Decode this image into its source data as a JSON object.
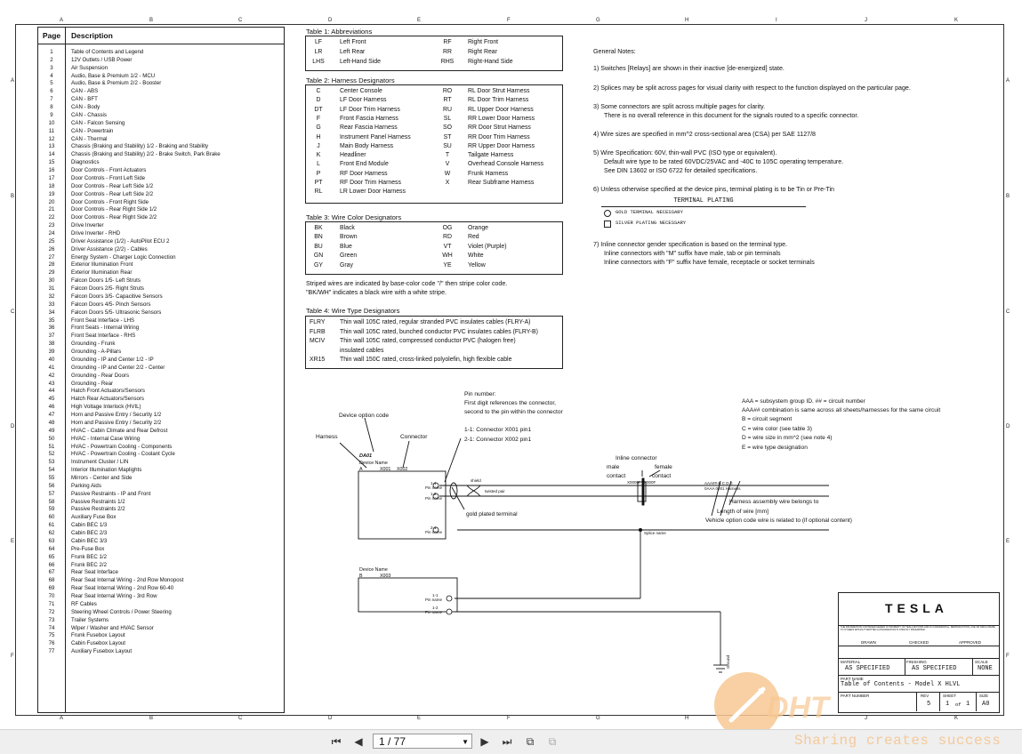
{
  "sheet": {
    "columns": [
      "A",
      "B",
      "C",
      "D",
      "E",
      "F",
      "G",
      "H",
      "I",
      "J",
      "K"
    ],
    "rows": [
      "A",
      "B",
      "C",
      "D",
      "E",
      "F"
    ]
  },
  "toc": {
    "header_page": "Page",
    "header_description": "Description",
    "rows": [
      [
        "1",
        "Table of Contents and Legend"
      ],
      [
        "2",
        "12V Outlets / USB Power"
      ],
      [
        "3",
        "Air Suspension"
      ],
      [
        "4",
        "Audio, Base & Premium 1/2 - MCU"
      ],
      [
        "5",
        "Audio, Base & Premium 2/2 - Booster"
      ],
      [
        "6",
        "CAN - ABS"
      ],
      [
        "7",
        "CAN - BFT"
      ],
      [
        "8",
        "CAN - Body"
      ],
      [
        "9",
        "CAN - Chassis"
      ],
      [
        "10",
        "CAN - Falcon Sensing"
      ],
      [
        "11",
        "CAN - Powertrain"
      ],
      [
        "12",
        "CAN - Thermal"
      ],
      [
        "13",
        "Chassis (Braking and Stability) 1/2 - Braking and Stability"
      ],
      [
        "14",
        "Chassis (Braking and Stability) 2/2 - Brake Switch, Park Brake"
      ],
      [
        "15",
        "Diagnostics"
      ],
      [
        "16",
        "Door Controls - Front Actuators"
      ],
      [
        "17",
        "Door Controls - Front Left Side"
      ],
      [
        "18",
        "Door Controls - Rear Left Side 1/2"
      ],
      [
        "19",
        "Door Controls - Rear Left Side 2/2"
      ],
      [
        "20",
        "Door Controls - Front Right Side"
      ],
      [
        "21",
        "Door Controls - Rear Right Side 1/2"
      ],
      [
        "22",
        "Door Controls - Rear Right Side 2/2"
      ],
      [
        "23",
        "Drive Inverter"
      ],
      [
        "24",
        "Drive Inverter - RHD"
      ],
      [
        "25",
        "Driver Assistance (1/2) - AutoPilot ECU 2"
      ],
      [
        "26",
        "Driver Assistance (2/2) - Cables"
      ],
      [
        "27",
        "Energy System - Charger Logic Connection"
      ],
      [
        "28",
        "Exterior Illumination Front"
      ],
      [
        "29",
        "Exterior Illumination Rear"
      ],
      [
        "30",
        "Falcon Doors 1/5- Left Struts"
      ],
      [
        "31",
        "Falcon Doors 2/5- Right Struts"
      ],
      [
        "32",
        "Falcon Doors 3/5- Capacitive Sensors"
      ],
      [
        "33",
        "Falcon Doors 4/5- Pinch Sensors"
      ],
      [
        "34",
        "Falcon Doors 5/5- Ultrasonic Sensors"
      ],
      [
        "35",
        "Front Seat Interface - LHS"
      ],
      [
        "36",
        "Front Seats - Internal Wiring"
      ],
      [
        "37",
        "Front Seat Interface - RHS"
      ],
      [
        "38",
        "Grounding - Frunk"
      ],
      [
        "39",
        "Grounding - A-Pillars"
      ],
      [
        "40",
        "Grounding - IP and Center 1/2 - IP"
      ],
      [
        "41",
        "Grounding - IP and Center 2/2 - Center"
      ],
      [
        "42",
        "Grounding - Rear Doors"
      ],
      [
        "43",
        "Grounding - Rear"
      ],
      [
        "44",
        "Hatch Front Actuators/Sensors"
      ],
      [
        "45",
        "Hatch Rear Actuators/Sensors"
      ],
      [
        "46",
        "High Voltage Interlock (HVIL)"
      ],
      [
        "47",
        "Horn and Passive Entry / Security 1/2"
      ],
      [
        "48",
        "Horn and Passive Entry / Security 2/2"
      ],
      [
        "49",
        "HVAC - Cabin Climate and Rear Defrost"
      ],
      [
        "50",
        "HVAC - Internal Case Wiring"
      ],
      [
        "51",
        "HVAC - Powertrain Cooling - Components"
      ],
      [
        "52",
        "HVAC - Powertrain Cooling - Coolant Cycle"
      ],
      [
        "53",
        "Instrument Cluster / LIN"
      ],
      [
        "54",
        "Interior Illumination Maplights"
      ],
      [
        "55",
        "Mirrors - Center and Side"
      ],
      [
        "56",
        "Parking Aids"
      ],
      [
        "57",
        "Passive Restraints - IP and Front"
      ],
      [
        "58",
        "Passive Restraints 1/2"
      ],
      [
        "59",
        "Passive Restraints 2/2"
      ],
      [
        "60",
        "Auxiliary Fuse Box"
      ],
      [
        "61",
        "Cabin BEC 1/3"
      ],
      [
        "62",
        "Cabin BEC 2/3"
      ],
      [
        "63",
        "Cabin BEC 3/3"
      ],
      [
        "64",
        "Pre-Fuse Box"
      ],
      [
        "65",
        "Frunk BEC 1/2"
      ],
      [
        "66",
        "Frunk BEC 2/2"
      ],
      [
        "67",
        "Rear Seat Interface"
      ],
      [
        "68",
        "Rear Seat Internal Wiring - 2nd Row Monopost"
      ],
      [
        "69",
        "Rear Seat Internal Wiring - 2nd Row 60-40"
      ],
      [
        "70",
        "Rear Seat Internal Wiring - 3rd Row"
      ],
      [
        "71",
        "RF Cables"
      ],
      [
        "72",
        "Steering Wheel Controls / Power Steering"
      ],
      [
        "73",
        "Trailer Systems"
      ],
      [
        "74",
        "Wiper / Washer and HVAC Sensor"
      ],
      [
        "75",
        "Frunk Fusebox Layout"
      ],
      [
        "76",
        "Cabin Fusebox Layout"
      ],
      [
        "77",
        "Auxiliary Fusebox Layout"
      ]
    ]
  },
  "tables": {
    "abbr": {
      "title": "Table 1: Abbreviations",
      "left": [
        [
          "LF",
          "Left Front"
        ],
        [
          "LR",
          "Left Rear"
        ],
        [
          "LHS",
          "Left-Hand Side"
        ]
      ],
      "right": [
        [
          "RF",
          "Right Front"
        ],
        [
          "RR",
          "Right Rear"
        ],
        [
          "RHS",
          "Right-Hand Side"
        ]
      ]
    },
    "harness": {
      "title": "Table 2: Harness Designators",
      "left": [
        [
          "C",
          "Center Console"
        ],
        [
          "D",
          "LF Door Harness"
        ],
        [
          "DT",
          "LF Door Trim Harness"
        ],
        [
          "F",
          "Front Fascia Harness"
        ],
        [
          "G",
          "Rear Fascia Harness"
        ],
        [
          "H",
          "Instrument Panel Harness"
        ],
        [
          "J",
          "Main Body Harness"
        ],
        [
          "K",
          "Headliner"
        ],
        [
          "L",
          "Front End Module"
        ],
        [
          "P",
          "RF Door Harness"
        ],
        [
          "PT",
          "RF Door Trim Harness"
        ],
        [
          "RL",
          "LR Lower Door Harness"
        ]
      ],
      "right": [
        [
          "RO",
          "RL Door Strut Harness"
        ],
        [
          "RT",
          "RL Door Trim Harness"
        ],
        [
          "RU",
          "RL Upper Door Harness"
        ],
        [
          "SL",
          "RR Lower Door Harness"
        ],
        [
          "SO",
          "RR Door Strut Harness"
        ],
        [
          "ST",
          "RR Door Trim Harness"
        ],
        [
          "SU",
          "RR Upper Door Harness"
        ],
        [
          "T",
          "Tailgate Harness"
        ],
        [
          "V",
          "Overhead Console Harness"
        ],
        [
          "W",
          "Frunk Harness"
        ],
        [
          "X",
          "Rear Subframe Harness"
        ]
      ]
    },
    "wirecolor": {
      "title": "Table 3: Wire Color Designators",
      "left": [
        [
          "BK",
          "Black"
        ],
        [
          "BN",
          "Brown"
        ],
        [
          "BU",
          "Blue"
        ],
        [
          "GN",
          "Green"
        ],
        [
          "GY",
          "Gray"
        ]
      ],
      "right": [
        [
          "OG",
          "Orange"
        ],
        [
          "RD",
          "Red"
        ],
        [
          "VT",
          "Violet (Purple)"
        ],
        [
          "WH",
          "White"
        ],
        [
          "YE",
          "Yellow"
        ]
      ],
      "note1": "Striped wires are indicated by base-color code \"/\" then stripe color code.",
      "note2": "\"BK/WH\" indicates a black wire with a white stripe."
    },
    "wiretype": {
      "title": "Table 4: Wire Type Designators",
      "rows": [
        [
          "FLRY",
          "Thin wall 105C rated, regular stranded PVC insulates cables (FLRY-A)"
        ],
        [
          "FLRB",
          "Thin wall 105C rated, bunched conductor PVC insulates cables (FLRY-B)"
        ],
        [
          "MCIV",
          "Thin wall 105C rated, compressed conductor PVC (halogen free)"
        ],
        [
          "",
          "insulated cables"
        ],
        [
          "XR15",
          "Thin wall 150C rated, cross-linked polyolefin, high flexible cable"
        ]
      ]
    }
  },
  "notes": {
    "title": "General Notes:",
    "lines": [
      "1) Switches [Relays] are shown in their inactive [de-energized] state.",
      "2) Splices may be split across pages for visual clarity with respect to the function displayed on the particular page.",
      "3) Some connectors are split across multiple pages for clarity.",
      "There is no overall reference in this document for the signals routed to a specific connector.",
      "4) Wire sizes are specified in mm^2 cross-sectional area (CSA) per SAE 1127/8",
      "5) Wire Specification: 60V, thin-wall PVC (ISO type or equivalent).",
      "Default wire type to be rated 60VDC/25VAC and -40C to 105C operating temperature.",
      "See DIN 13602 or ISO 6722 for detailed specifications.",
      "6) Unless otherwise specified at the device pins, terminal plating is to be Tin or Pre-Tin",
      "7) Inline connector gender specification is based on the terminal type.",
      "Inline connectors with \"M\" suffix have male, tab or pin terminals",
      "Inline connectors with \"F\" suffix have female, receptacle or socket terminals"
    ],
    "plating_title": "TERMINAL PLATING",
    "plating_gold": "GOLD TERMINAL NECESSARY",
    "plating_silver": "SILVER PLATING NECESSARY"
  },
  "legend": {
    "pin_number": "Pin number:",
    "pin_line1": "First digit references the connector,",
    "pin_line2": "second to the pin within the connector",
    "pin_ex1": "1-1: Connector X001 pin1",
    "pin_ex2": "2-1: Connector X002 pin1",
    "device_option": "Device option code",
    "harness": "Harness",
    "connector": "Connector",
    "dev_code": "DA01",
    "device_name": "Device Name",
    "dev_letter": "A",
    "x001": "X001",
    "x002": "X002",
    "pin11": "1-1",
    "pin12": "1-2",
    "pin21": "2-1",
    "pin_name": "Pin name",
    "shield": "shield",
    "twisted": "twisted pair",
    "gold": "gold plated terminal",
    "inline": "Inline connector",
    "male": "male",
    "contact": "contact",
    "female": "female",
    "xm": "X000M",
    "xf": "X000F",
    "aaa1": "AAA = subsystem group ID. ## = circuit number",
    "aaa2": "AAA## combination is same across all sheets/harnesses for the same circuit",
    "aaa3": "B = circuit segment",
    "aaa4": "C = wire color (see table 3)",
    "aaa5": "D = wire size in mm^2 (see note 4)",
    "aaa6": "E = wire type designation",
    "wire_code": "AAA##-B  C  D  E",
    "wire_code2": "0AAA  0001  Harness",
    "harness_belongs": "Harness assembly wire belongs to",
    "length": "Length of wire [mm]",
    "vehicle_option": "Vehicle option code wire is related to (if optional content)",
    "splice": "Splice name",
    "dev2_name": "Device Name",
    "dev2_letter": "B",
    "x003": "X003",
    "ground": "Ground"
  },
  "titleblock": {
    "brand": "TESLA",
    "confidential": "THE INFORMATION CONTAINED HEREIN IS PROPERTY OF TESLA MOTORS AND IS CONFIDENTIAL. REPRODUCTION, USE OR DISCLOSURE TO OTHERS WITHOUT WRITTEN AUTHORIZATION IS STRICTLY PROHIBITED.",
    "drawn": "DRAWN",
    "checked": "CHECKED",
    "approved": "APPROVED",
    "material_lbl": "MATERIAL",
    "material": "AS SPECIFIED",
    "finishing_lbl": "FINISHING",
    "finishing": "AS SPECIFIED",
    "scale_lbl": "SCALE",
    "scale": "NONE",
    "partname_lbl": "PART NAME",
    "partname": "Table of Contents - Model X HLVL",
    "partnum_lbl": "PART NUMBER",
    "rev_lbl": "REV",
    "rev": "5",
    "sheet_lbl": "SHEET",
    "sheet": "1",
    "of": "of",
    "sheets": "1",
    "size_lbl": "SIZE",
    "size": "A0"
  },
  "viewer": {
    "page_value": "1 / 77",
    "first_icon": "first-page-icon",
    "prev_icon": "prev-page-icon",
    "next_icon": "next-page-icon",
    "last_icon": "last-page-icon"
  },
  "watermark": {
    "logo": "DHT",
    "tagline": "Sharing creates success"
  }
}
